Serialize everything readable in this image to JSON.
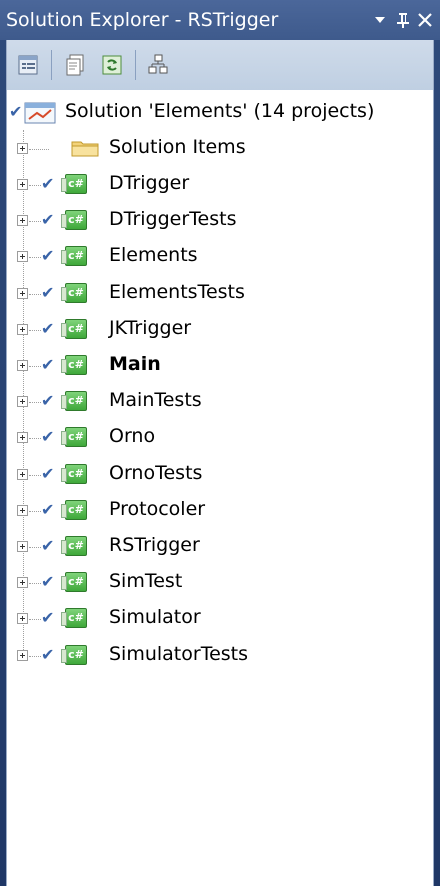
{
  "window": {
    "title": "Solution Explorer - RSTrigger",
    "dropdown_glyph": "▾",
    "pin_glyph": "ㅍ",
    "close_glyph": "✕"
  },
  "toolbar": {
    "buttons": [
      {
        "name": "properties-icon"
      },
      {
        "name": "show-all-files-icon"
      },
      {
        "name": "refresh-icon"
      },
      {
        "name": "class-diagram-icon"
      }
    ]
  },
  "tree": {
    "root_label": "Solution 'Elements' (14 projects)",
    "solution_items_label": "Solution Items",
    "projects": [
      {
        "label": "DTrigger",
        "bold": false
      },
      {
        "label": "DTriggerTests",
        "bold": false
      },
      {
        "label": "Elements",
        "bold": false
      },
      {
        "label": "ElementsTests",
        "bold": false
      },
      {
        "label": "JKTrigger",
        "bold": false
      },
      {
        "label": "Main",
        "bold": true
      },
      {
        "label": "MainTests",
        "bold": false
      },
      {
        "label": "Orno",
        "bold": false
      },
      {
        "label": "OrnoTests",
        "bold": false
      },
      {
        "label": "Protocoler",
        "bold": false
      },
      {
        "label": "RSTrigger",
        "bold": false
      },
      {
        "label": "SimTest",
        "bold": false
      },
      {
        "label": "Simulator",
        "bold": false
      },
      {
        "label": "SimulatorTests",
        "bold": false
      }
    ],
    "project_icon_text": "c#",
    "check_glyph": "✔"
  }
}
